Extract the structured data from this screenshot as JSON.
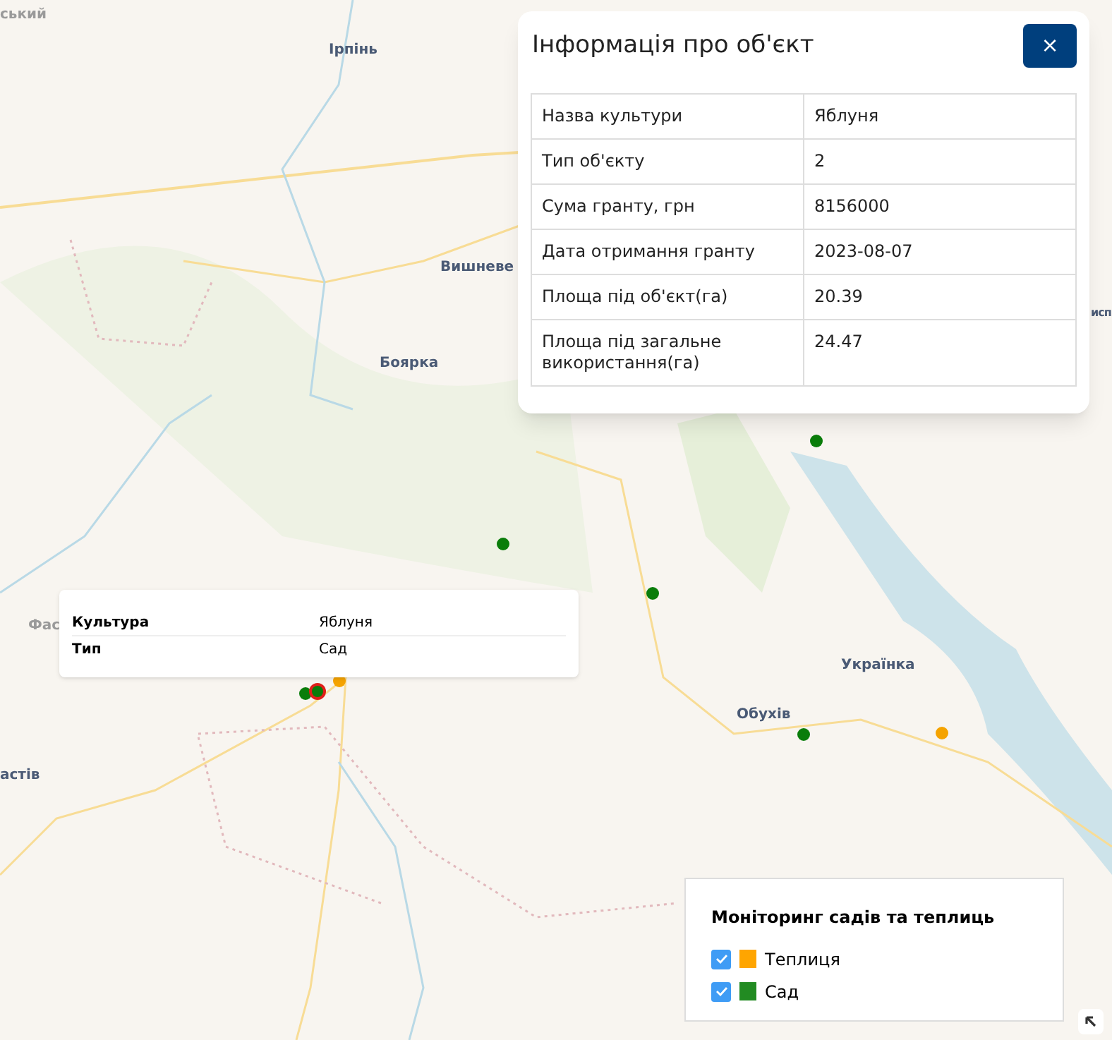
{
  "map": {
    "labels": [
      {
        "text": "ський"
      },
      {
        "text": "Ірпінь"
      },
      {
        "text": "Вишневе"
      },
      {
        "text": "Боярка"
      },
      {
        "text": "исп"
      },
      {
        "text": "Фас"
      },
      {
        "text": "астів"
      },
      {
        "text": "Українка"
      },
      {
        "text": "Обухів"
      }
    ],
    "markers": [
      {
        "color": "#0a7d0a",
        "selected": false
      },
      {
        "color": "#0a7d0a",
        "selected": false
      },
      {
        "color": "#0a7d0a",
        "selected": false
      },
      {
        "color": "#0a7d0a",
        "selected": false
      },
      {
        "color": "#f5a300",
        "selected": false
      },
      {
        "color": "#0a7d0a",
        "selected": false
      },
      {
        "color": "#f5a300",
        "selected": false
      },
      {
        "color": "#0a7d0a",
        "selected": true
      }
    ]
  },
  "info_popup": {
    "title": "Інформація про об'єкт",
    "close_label": "×",
    "rows": [
      {
        "label": "Назва культури",
        "value": "Яблуня"
      },
      {
        "label": "Тип об'єкту",
        "value": "2"
      },
      {
        "label": "Сума гранту, грн",
        "value": "8156000"
      },
      {
        "label": "Дата отримання гранту",
        "value": "2023-08-07"
      },
      {
        "label": "Площа під об'єкт(га)",
        "value": "20.39"
      },
      {
        "label": "Площа під загальне використання(га)",
        "value": "24.47"
      }
    ]
  },
  "tooltip": {
    "rows": [
      {
        "label": "Культура",
        "value": "Яблуня"
      },
      {
        "label": "Тип",
        "value": "Сад"
      }
    ]
  },
  "legend": {
    "title": "Моніторинг садів та теплиць",
    "items": [
      {
        "label": "Теплиця",
        "checked": true,
        "color": "#ffa500"
      },
      {
        "label": "Сад",
        "checked": true,
        "color": "#228b22"
      }
    ]
  }
}
